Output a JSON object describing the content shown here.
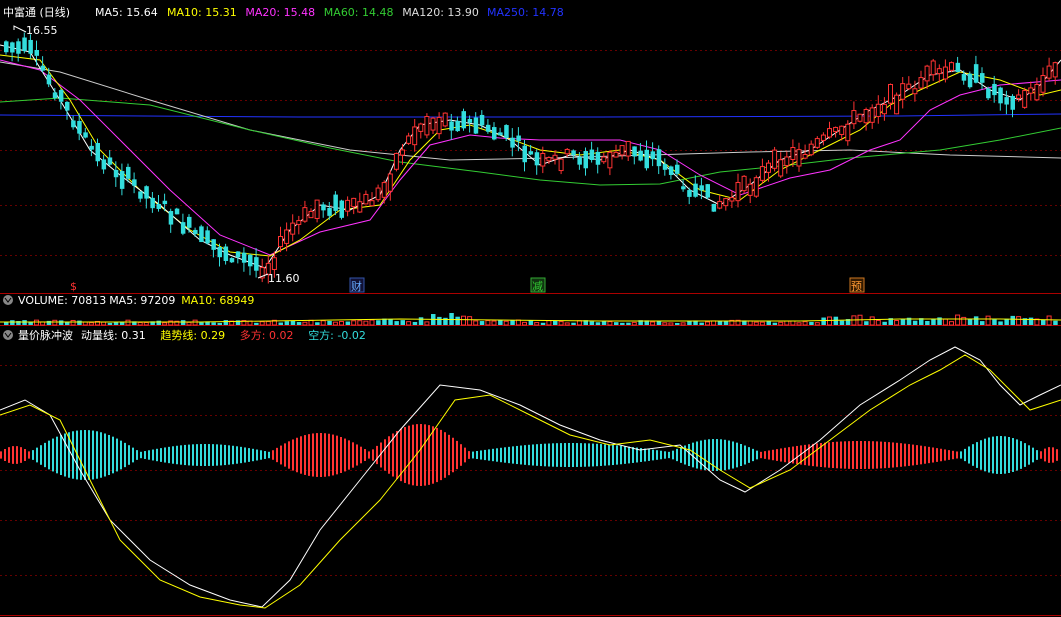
{
  "main_panel": {
    "stock_name": "中富通 (日线)",
    "ma_legend": [
      {
        "label": "MA5: 15.64",
        "color": "#ffffff"
      },
      {
        "label": "MA10: 15.31",
        "color": "#ffff00"
      },
      {
        "label": "MA20: 15.48",
        "color": "#ff33ff"
      },
      {
        "label": "MA60: 14.48",
        "color": "#33cc33"
      },
      {
        "label": "MA120: 13.90",
        "color": "#dddddd"
      },
      {
        "label": "MA250: 14.78",
        "color": "#2233ff"
      }
    ],
    "high_label": "16.55",
    "low_label": "11.60",
    "event_markers": [
      {
        "text": "$",
        "color": "#ff3333"
      },
      {
        "text": "财",
        "color": "#66aaff"
      },
      {
        "text": "减",
        "color": "#33cc33"
      },
      {
        "text": "预",
        "color": "#ff9933"
      }
    ]
  },
  "volume_panel": {
    "legend": [
      {
        "label": "VOLUME: 70813",
        "color": "#ffffff"
      },
      {
        "label": "MA5: 97209",
        "color": "#ffffff"
      },
      {
        "label": "MA10: 68949",
        "color": "#ffff00"
      }
    ]
  },
  "indicator_panel": {
    "legend": [
      {
        "label": "量价脉冲波",
        "color": "#ffffff"
      },
      {
        "label": "动量线: 0.31",
        "color": "#ffffff"
      },
      {
        "label": "趋势线: 0.29",
        "color": "#ffff00"
      },
      {
        "label": "多方: 0.02",
        "color": "#ff3333"
      },
      {
        "label": "空方: -0.02",
        "color": "#33dddd"
      }
    ]
  },
  "colors": {
    "up": "#ff3333",
    "down": "#33dddd",
    "background": "#000000",
    "grid": "#880000"
  },
  "chart_data": {
    "type": "candlestick",
    "price_high": 16.55,
    "price_low": 11.6,
    "last_values": {
      "MA5": 15.64,
      "MA10": 15.31,
      "MA20": 15.48,
      "MA60": 14.48,
      "MA120": 13.9,
      "MA250": 14.78,
      "VOLUME": 70813,
      "VOL_MA5": 97209,
      "VOL_MA10": 68949,
      "momentum": 0.31,
      "trend": 0.29,
      "bull": 0.02,
      "bear": -0.02
    }
  }
}
